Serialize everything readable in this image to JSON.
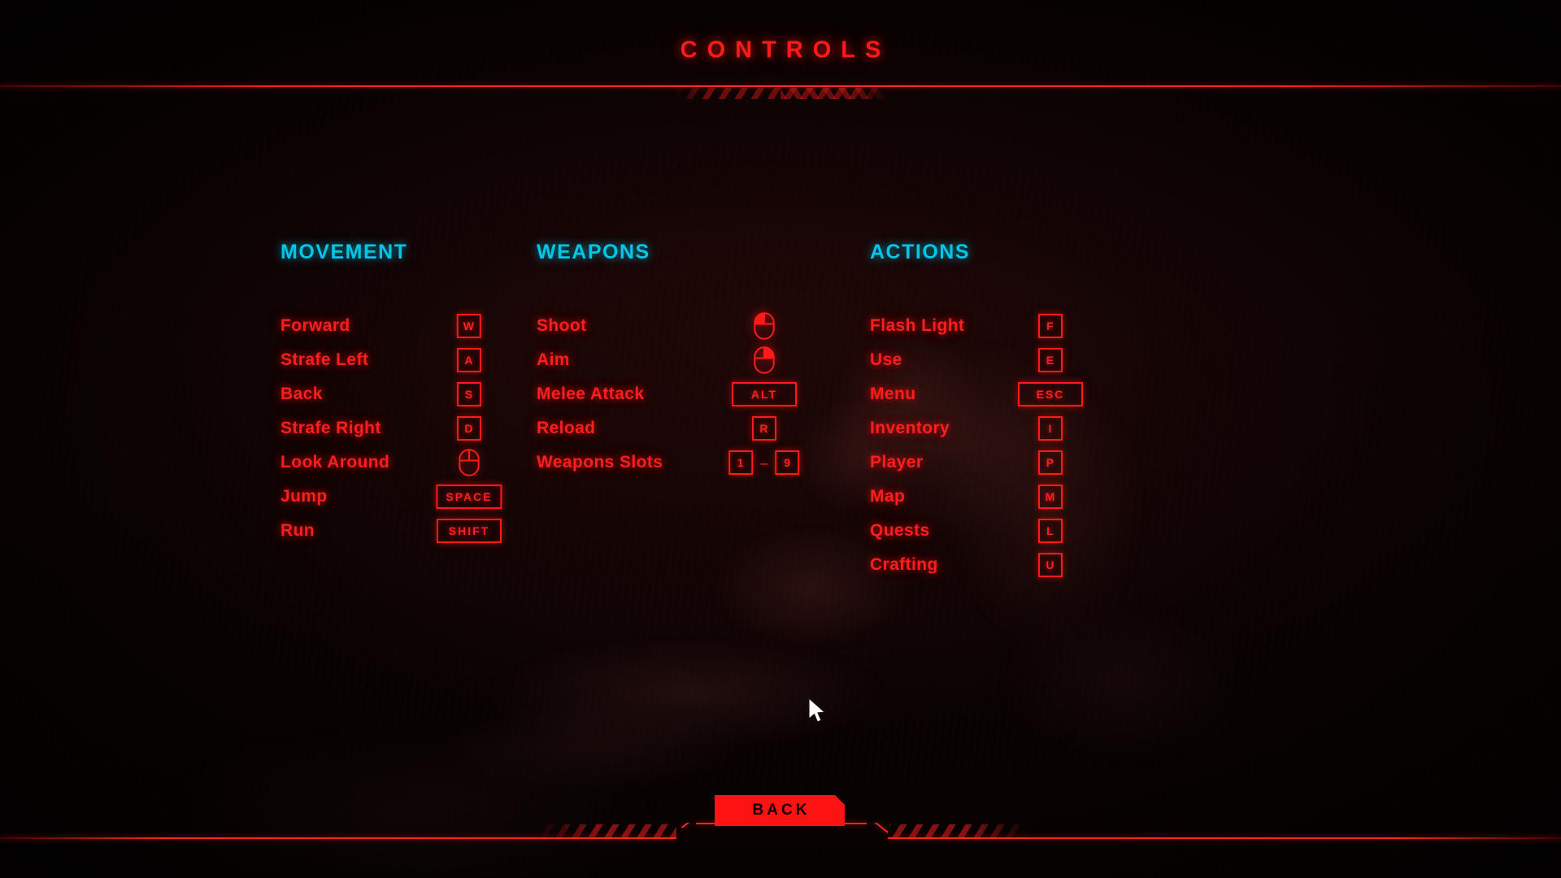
{
  "screen": {
    "title": "CONTROLS",
    "accent_red": "#ff1a1a",
    "accent_cyan": "#00c6e6",
    "background": "#120404"
  },
  "columns": [
    {
      "heading": "MOVEMENT",
      "rows": [
        {
          "label": "Forward",
          "key_type": "cap",
          "keys": [
            "W"
          ]
        },
        {
          "label": "Strafe Left",
          "key_type": "cap",
          "keys": [
            "A"
          ]
        },
        {
          "label": "Back",
          "key_type": "cap",
          "keys": [
            "S"
          ]
        },
        {
          "label": "Strafe Right",
          "key_type": "cap",
          "keys": [
            "D"
          ]
        },
        {
          "label": "Look Around",
          "key_type": "mouse",
          "mouse": "none"
        },
        {
          "label": "Jump",
          "key_type": "wide",
          "keys": [
            "SPACE"
          ]
        },
        {
          "label": "Run",
          "key_type": "wide",
          "keys": [
            "SHIFT"
          ]
        }
      ]
    },
    {
      "heading": "WEAPONS",
      "rows": [
        {
          "label": "Shoot",
          "key_type": "mouse",
          "mouse": "left"
        },
        {
          "label": "Aim",
          "key_type": "mouse",
          "mouse": "right"
        },
        {
          "label": "Melee Attack",
          "key_type": "wide",
          "keys": [
            "ALT"
          ]
        },
        {
          "label": "Reload",
          "key_type": "cap",
          "keys": [
            "R"
          ]
        },
        {
          "label": "Weapons Slots",
          "key_type": "range",
          "keys": [
            "1",
            "9"
          ],
          "separator": "–"
        }
      ]
    },
    {
      "heading": "ACTIONS",
      "rows": [
        {
          "label": "Flash Light",
          "key_type": "cap",
          "keys": [
            "F"
          ]
        },
        {
          "label": "Use",
          "key_type": "cap",
          "keys": [
            "E"
          ]
        },
        {
          "label": "Menu",
          "key_type": "wide",
          "keys": [
            "ESC"
          ]
        },
        {
          "label": "Inventory",
          "key_type": "cap",
          "keys": [
            "I"
          ]
        },
        {
          "label": "Player",
          "key_type": "cap",
          "keys": [
            "P"
          ]
        },
        {
          "label": "Map",
          "key_type": "cap",
          "keys": [
            "M"
          ]
        },
        {
          "label": "Quests",
          "key_type": "cap",
          "keys": [
            "L"
          ]
        },
        {
          "label": "Crafting",
          "key_type": "cap",
          "keys": [
            "U"
          ]
        }
      ]
    }
  ],
  "footer": {
    "back_label": "BACK"
  }
}
